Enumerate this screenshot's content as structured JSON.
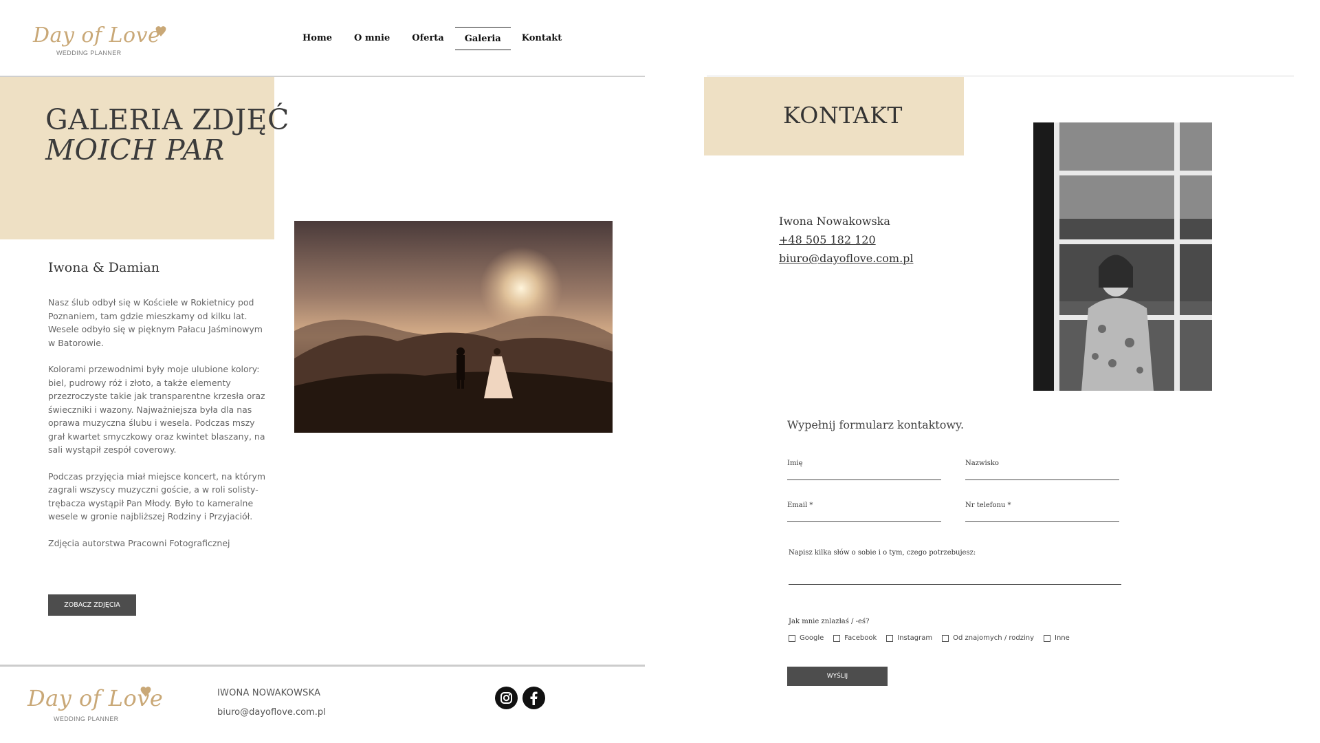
{
  "logo": {
    "script_text": "Day of Love",
    "subtitle": "WEDDING PLANNER"
  },
  "nav": {
    "items": [
      {
        "label": "Home"
      },
      {
        "label": "O mnie"
      },
      {
        "label": "Oferta"
      },
      {
        "label": "Galeria",
        "active": true
      },
      {
        "label": "Kontakt"
      }
    ]
  },
  "gallery": {
    "title_line1": "GALERIA ZDJĘĆ",
    "title_line2": "MOICH PAR",
    "couple_name": "Iwona & Damian",
    "paragraphs": [
      "Nasz ślub odbył się w Kościele w Rokietnicy pod Poznaniem, tam gdzie mieszkamy od kilku lat. Wesele odbyło się w pięknym Pałacu Jaśminowym w Batorowie.",
      "Kolorami przewodnimi były moje ulubione kolory: biel, pudrowy róż i złoto, a także elementy przezroczyste takie jak transparentne krzesła oraz świeczniki i wazony. Najważniejsza była dla nas oprawa muzyczna ślubu i wesela. Podczas mszy grał kwartet smyczkowy oraz kwintet blaszany, na sali wystąpił zespół coverowy.",
      "Podczas przyjęcia miał miejsce koncert, na którym zagrali wszyscy muzyczni goście, a w roli solisty-trębacza wystąpił Pan Młody. Było to kameralne wesele w gronie najbliższej Rodziny i Przyjaciół.",
      "Zdjęcia autorstwa Pracowni Fotograficznej"
    ],
    "button_label": "ZOBACZ ZDJĘCIA"
  },
  "contact": {
    "title": "KONTAKT",
    "name": "Iwona Nowakowska",
    "phone": "+48 505 182 120",
    "email": "biuro@dayoflove.com.pl",
    "form_heading": "Wypełnij formularz kontaktowy.",
    "fields": {
      "first_name": "Imię",
      "last_name": "Nazwisko",
      "email": "Email *",
      "phone": "Nr telefonu *",
      "message": "Napisz kilka słów o sobie i o tym, czego potrzebujesz:"
    },
    "how_found_label": "Jak mnie znlazłaś / -eś?",
    "options": [
      "Google",
      "Facebook",
      "Instagram",
      "Od znajomych / rodziny",
      "Inne"
    ],
    "submit_label": "WYŚLIJ"
  },
  "footer": {
    "name": "IWONA NOWAKOWSKA",
    "email": "biuro@dayoflove.com.pl",
    "social": [
      "instagram-icon",
      "facebook-icon"
    ]
  },
  "colors": {
    "beige": "#eee0c4",
    "gold": "#c9a877",
    "button": "#4d4d4d"
  }
}
